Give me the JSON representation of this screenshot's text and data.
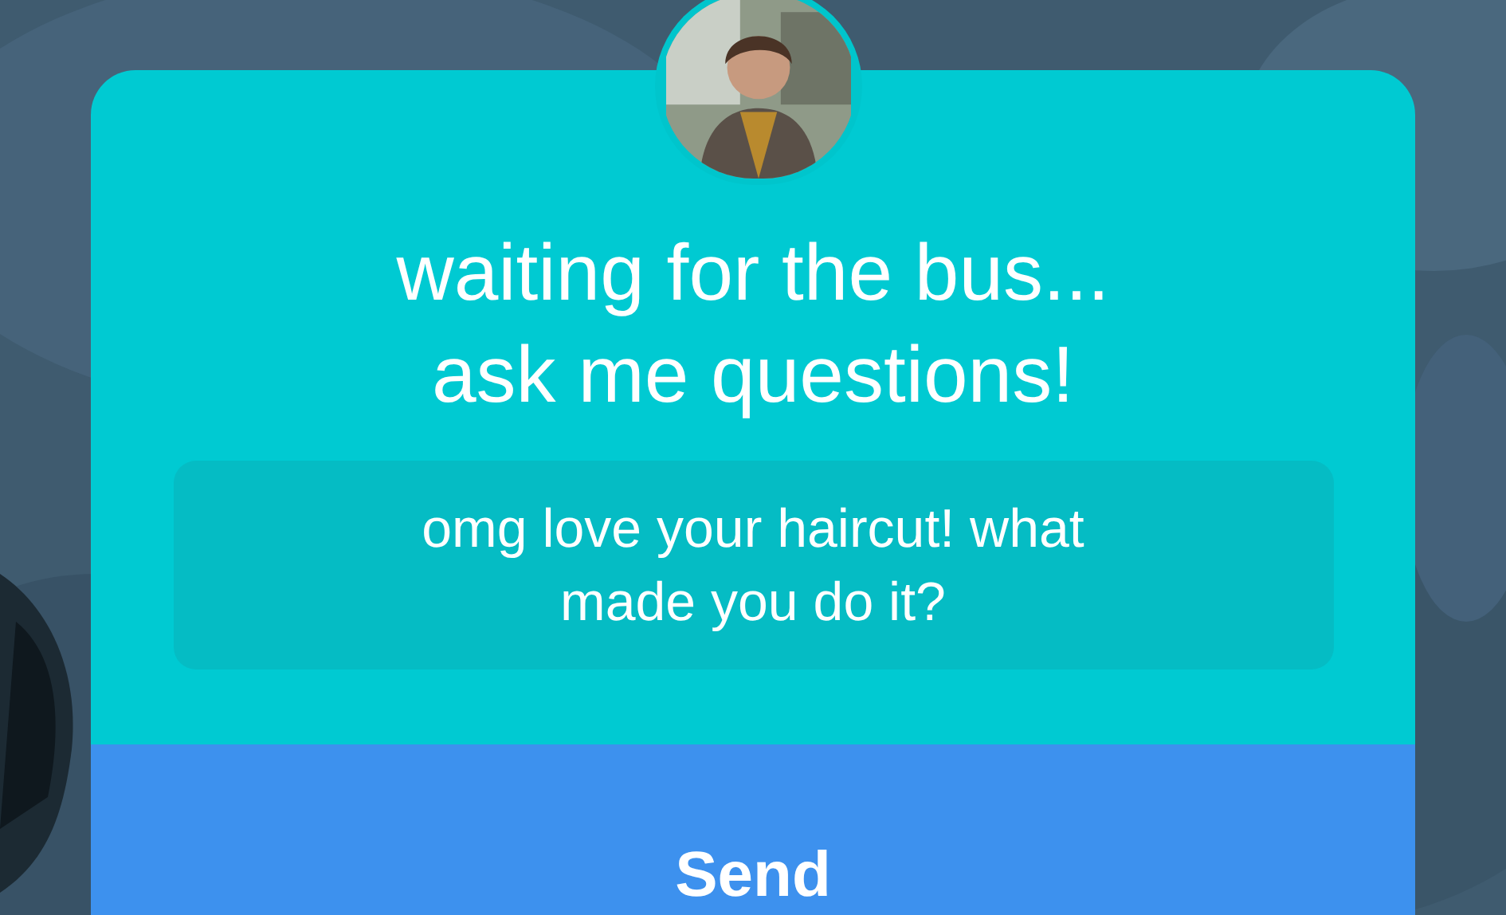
{
  "sticker": {
    "title": "waiting for the bus... ask me questions!",
    "answer": {
      "value": "omg love your haircut! what made you do it?"
    },
    "send_button": "Send"
  }
}
